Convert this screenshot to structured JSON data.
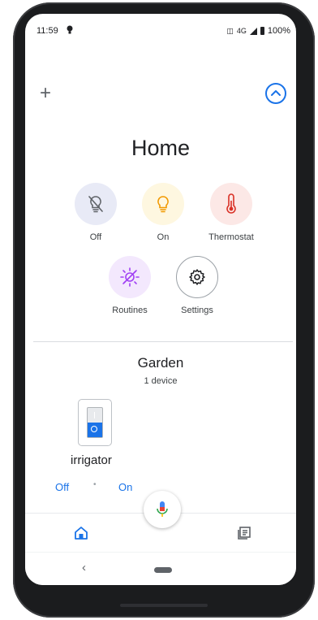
{
  "status_bar": {
    "time": "11:59",
    "network": "4G",
    "battery": "100%"
  },
  "header": {
    "title": "Home"
  },
  "shortcuts": [
    {
      "label": "Off",
      "icon": "lightbulb-off-icon",
      "bg": "#e8eaf6"
    },
    {
      "label": "On",
      "icon": "lightbulb-on-icon",
      "bg": "#fef7e0"
    },
    {
      "label": "Thermostat",
      "icon": "thermometer-icon",
      "bg": "#fce8e6"
    },
    {
      "label": "Routines",
      "icon": "sun-routine-icon",
      "bg": "#f3e8fd"
    },
    {
      "label": "Settings",
      "icon": "gear-icon",
      "bg": "#ffffff"
    }
  ],
  "room": {
    "name": "Garden",
    "device_count": "1 device",
    "device": {
      "name": "irrigator",
      "off_label": "Off",
      "on_label": "On"
    }
  },
  "colors": {
    "accent": "#1a73e8"
  }
}
